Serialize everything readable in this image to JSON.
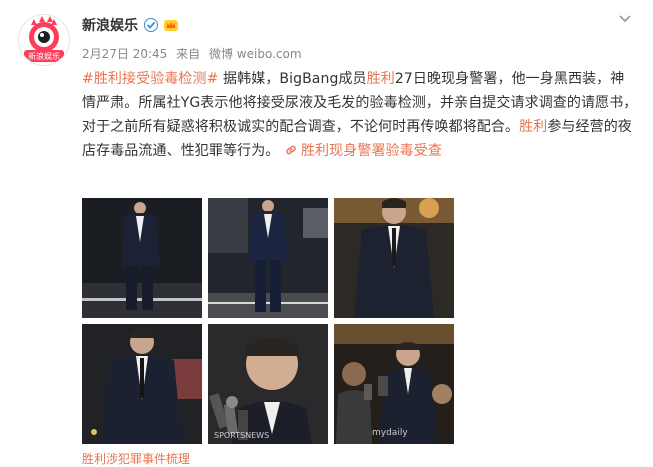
{
  "account": {
    "name": "新浪娱乐",
    "avatar_text": "新浪娱乐"
  },
  "meta": {
    "date": "2月27日 20:45",
    "source_prefix": "来自",
    "source": "微博 weibo.com"
  },
  "post": {
    "hashtag": "#胜利接受验毒检测#",
    "seg1": " 据韩媒，BigBang成员",
    "kw1": "胜利",
    "seg2": "27日晚现身警署，他一身黑西装，神情严肃。所属社YG表示他将接受尿液及毛发的验毒检测，并亲自提交请求调查的请愿书，对于之前所有疑惑将积极诚实的配合调查，不论何时再传唤都将配合。",
    "kw2": "胜利",
    "seg3": "参与经营的夜店存毒品流通、性犯罪等行为。 ",
    "link_text": "胜利现身警署验毒受查"
  },
  "photos": [
    {
      "watermark": ""
    },
    {
      "watermark": ""
    },
    {
      "watermark": ""
    },
    {
      "watermark": ""
    },
    {
      "watermark": "SPORTSNEWS"
    },
    {
      "watermark": "mydaily"
    }
  ],
  "footer_cut": "胜利涉犯罪事件梳理",
  "colors": {
    "link": "#eb7350",
    "text": "#333333",
    "meta": "#888888",
    "verified": "#ffc107"
  },
  "icons": [
    "chevron-down-icon",
    "verified-icon",
    "vip-crown-icon",
    "link-icon"
  ]
}
